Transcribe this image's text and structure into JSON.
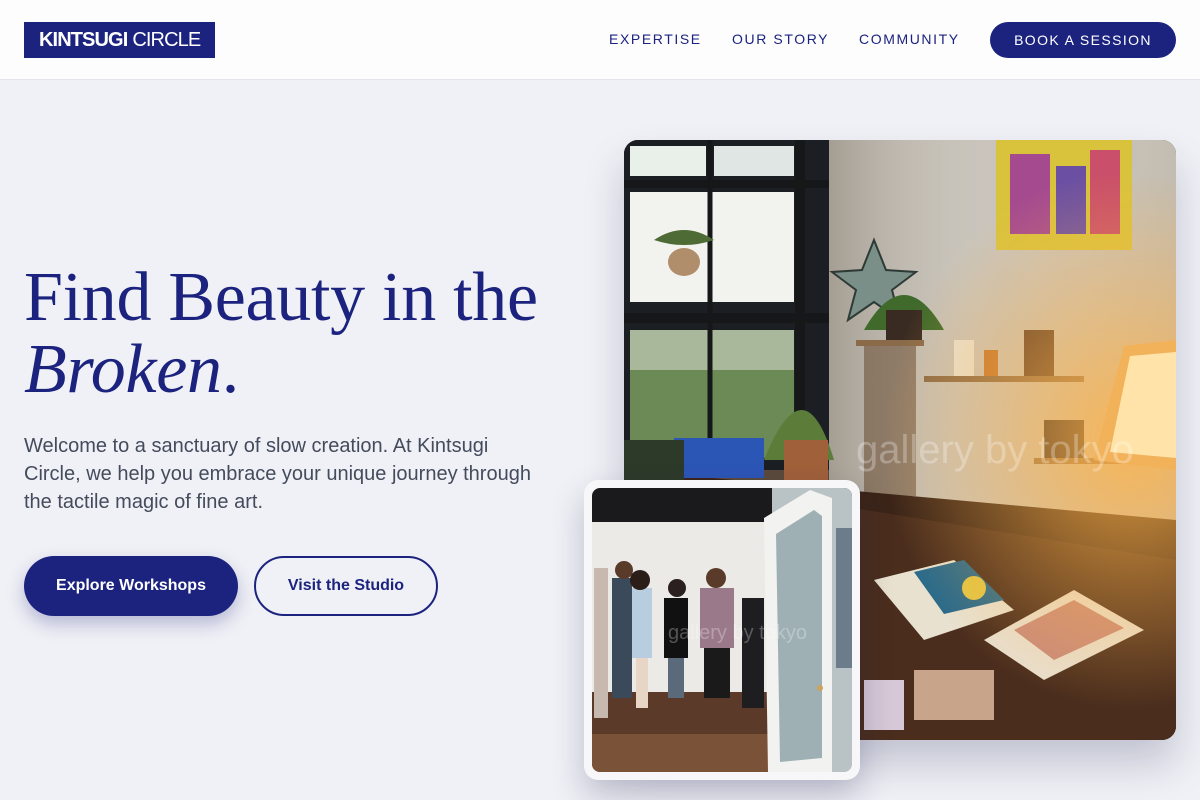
{
  "header": {
    "logo_bold": "KINTSUGI",
    "logo_light": "CIRCLE",
    "nav": {
      "expertise": "EXPERTISE",
      "story": "OUR STORY",
      "community": "COMMUNITY"
    },
    "cta": "BOOK A SESSION"
  },
  "hero": {
    "title_line1": "Find Beauty in the",
    "title_word_italic": "Broken",
    "title_punct": ".",
    "description": "Welcome to a sanctuary of slow creation. At Kintsugi Circle, we help you embrace your unique journey through the tactile magic of fine art.",
    "primary_button": "Explore Workshops",
    "secondary_button": "Visit the Studio"
  },
  "images": {
    "studio_watermark": "gallery by tokyo",
    "gallery_watermark": "gallery by tokyo"
  },
  "colors": {
    "brand_navy": "#1c237f",
    "page_background": "#f0f1f6",
    "body_text": "#444b5c",
    "header_background": "#fdfdfe"
  }
}
